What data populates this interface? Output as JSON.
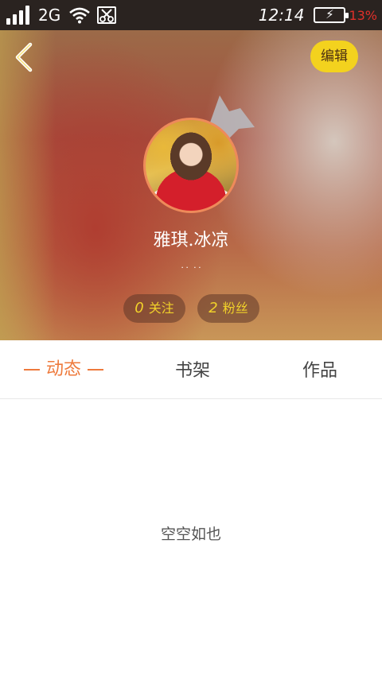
{
  "status_bar": {
    "network": "2G",
    "time": "12:14",
    "battery_percent": "13%",
    "icons": [
      "signal-icon",
      "wifi-icon",
      "scissors-icon",
      "battery-charging-icon"
    ]
  },
  "header": {
    "back_icon": "chevron-left-icon",
    "edit_label": "编辑",
    "crown_icon": "crown-icon",
    "username": "雅琪.冰凉",
    "signature": "˙˙ ˙˙",
    "stats": {
      "following_count": "0",
      "following_label": "关注",
      "fans_count": "2",
      "fans_label": "粉丝"
    }
  },
  "tabs": [
    {
      "label": "动态",
      "active": true
    },
    {
      "label": "书架",
      "active": false
    },
    {
      "label": "作品",
      "active": false
    }
  ],
  "content": {
    "empty_text": "空空如也"
  },
  "colors": {
    "accent_orange": "#ee7a3c",
    "edit_button_yellow": "#f3d21e",
    "stat_text_yellow": "#f1d12a",
    "status_bar_bg": "#2a2320"
  }
}
